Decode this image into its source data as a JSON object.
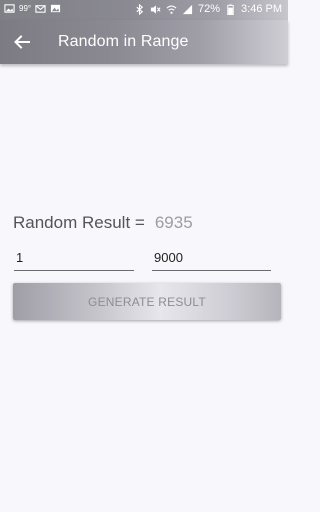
{
  "status_bar": {
    "left_indicator": "99°",
    "battery": "72%",
    "time": "3:46 PM"
  },
  "app_bar": {
    "title": "Random in Range"
  },
  "result": {
    "label": "Random Result =",
    "value": "6935"
  },
  "inputs": {
    "min_value": "1",
    "max_value": "9000"
  },
  "generate_button": {
    "label": "GENERATE RESULT"
  },
  "colors": {
    "bar_gradient_start": "#7c7b83",
    "bar_gradient_end": "#cfced5",
    "background": "#f8f7fb",
    "result_value": "#9c9ca3"
  }
}
